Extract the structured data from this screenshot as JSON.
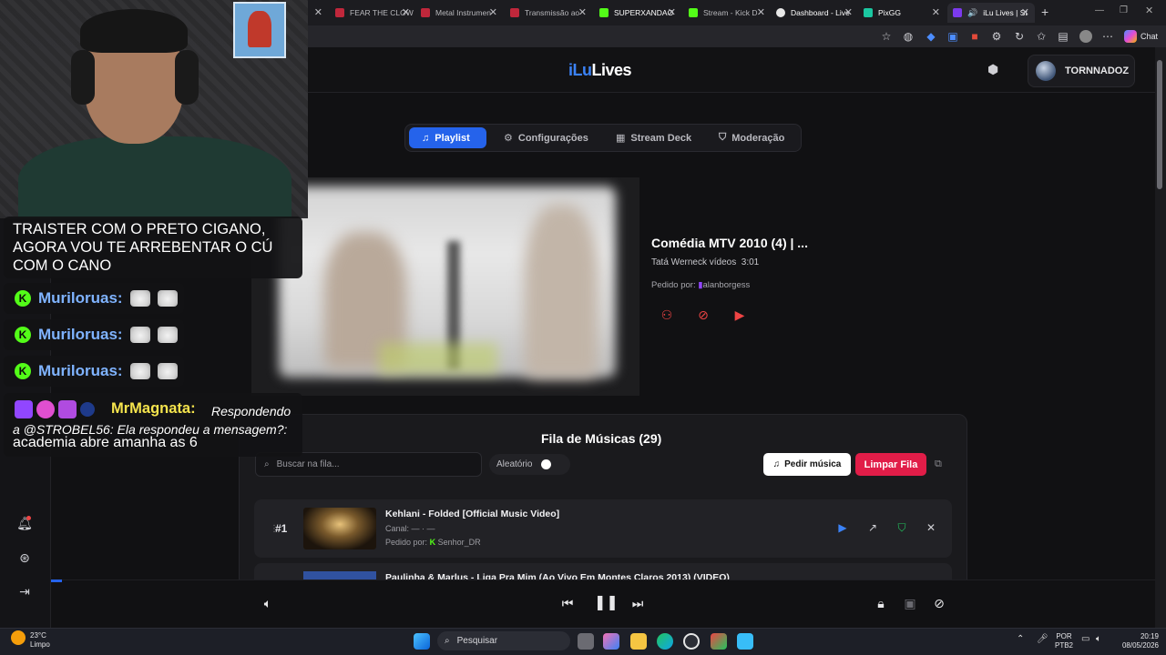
{
  "browser": {
    "tabs": [
      {
        "label": "",
        "color": "#d8394b"
      },
      {
        "label": "FEAR THE CLOW",
        "color": "#c0273b"
      },
      {
        "label": "Metal Instrumen",
        "color": "#c0273b"
      },
      {
        "label": "Transmissão ao",
        "color": "#c0273b"
      },
      {
        "label": "SUPERXANDAO",
        "color": "#53fc18"
      },
      {
        "label": "Stream - Kick D",
        "color": "#53fc18"
      },
      {
        "label": "Dashboard - Live",
        "color": "#e8e8e8"
      },
      {
        "label": "PixGG",
        "color": "#1bc7a1"
      },
      {
        "label": "iLu Lives | St",
        "color": "#7c3aed",
        "active": true
      }
    ],
    "new_tab": "+",
    "chat_label": "Chat"
  },
  "app": {
    "logo_a": "iLu",
    "logo_b": "Lives",
    "username": "TORNNADOZ",
    "accent": "#2563eb",
    "danger": "#e11d48"
  },
  "tabs": [
    {
      "label": "Playlist",
      "icon": "music-icon"
    },
    {
      "label": "Configurações",
      "icon": "gear-icon"
    },
    {
      "label": "Stream Deck",
      "icon": "grid-icon"
    },
    {
      "label": "Moderação",
      "icon": "shield-icon"
    }
  ],
  "now_playing": {
    "title": "Comédia MTV 2010 (4) | ...",
    "channel": "Tatá Werneck vídeos",
    "duration": "3:01",
    "requested_by_label": "Pedido por:",
    "requested_by": "alanborgess"
  },
  "queue": {
    "title": "Fila de Músicas (29)",
    "search_placeholder": "Buscar na fila...",
    "shuffle_label": "Aleatório",
    "request_button": "Pedir música",
    "clear_button": "Limpar Fila",
    "items": [
      {
        "rank": "#1",
        "title": "Kehlani - Folded [Official Music Video]",
        "channel": "Canal: — · —",
        "requested": "Pedido por:",
        "user": "Senhor_DR"
      },
      {
        "rank": "#2",
        "title": "Paulinha & Marlus - Liga Pra Mim (Ao Vivo Em Montes Claros 2013) (VIDEO)",
        "channel": "",
        "requested": "",
        "user": ""
      }
    ]
  },
  "overlay": {
    "message_1": "TRAISTER COM O PRETO CIGANO, AGORA VOU TE ARREBENTAR O CÚ COM O CANO",
    "kick_user": "Muriloruas:",
    "kick_badge": "K",
    "mm_user": "MrMagnata:",
    "mm_reply": "Respondendo a @STROBEL56: Ela respondeu a mensagem?:",
    "mm_text": "academia abre amanha as 6"
  },
  "taskbar": {
    "weather_temp": "23°C",
    "weather_desc": "Limpo",
    "search": "Pesquisar",
    "lang_a": "POR",
    "lang_b": "PTB2",
    "time": "20:19",
    "date": "08/05/2026"
  }
}
